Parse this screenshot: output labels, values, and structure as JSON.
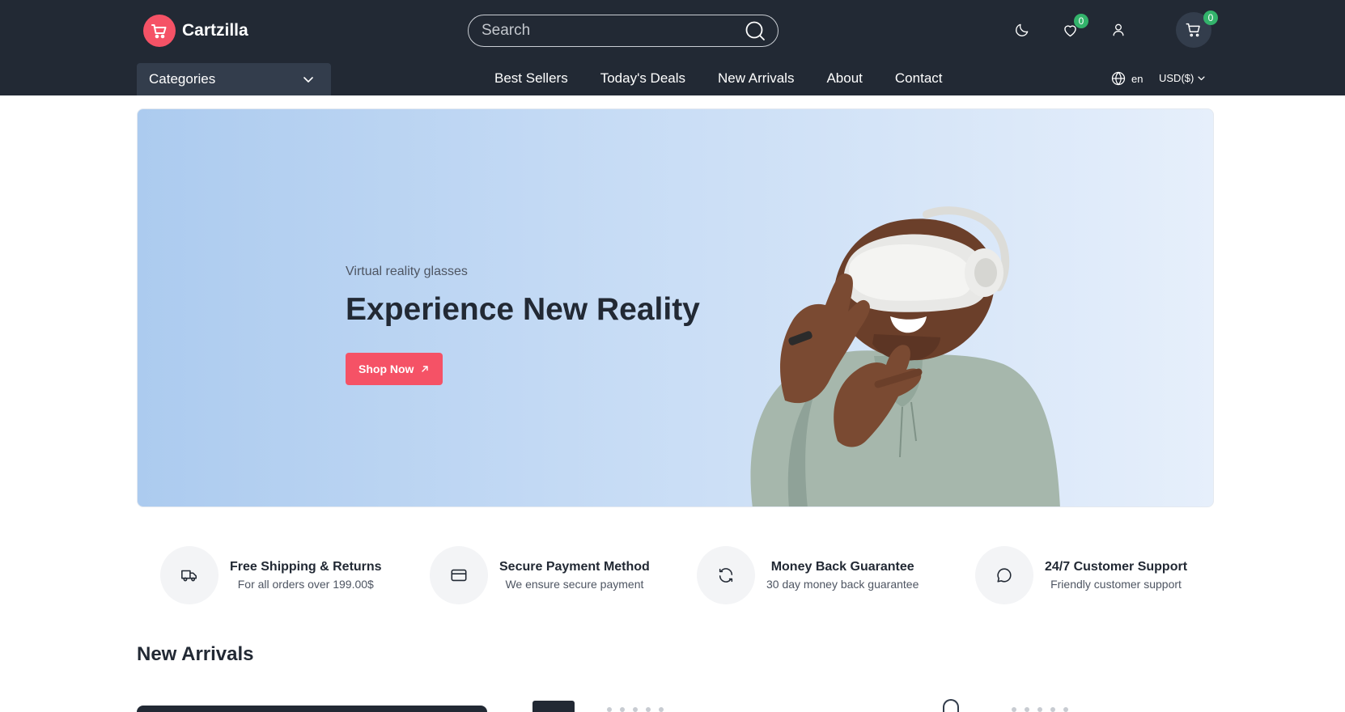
{
  "brand": {
    "name": "Cartzilla",
    "color": "#f55266"
  },
  "header": {
    "search": {
      "placeholder": "Search",
      "value": ""
    },
    "wishlist_count": "0",
    "cart_count": "0",
    "icons": [
      "moon-icon",
      "heart-icon",
      "user-icon",
      "cart-icon"
    ]
  },
  "nav": {
    "categories_label": "Categories",
    "links": [
      "Best Sellers",
      "Today's Deals",
      "New Arrivals",
      "About",
      "Contact"
    ],
    "language": "en",
    "currency": "USD($)"
  },
  "hero": {
    "subtitle": "Virtual reality glasses",
    "title": "Experience New Reality",
    "button_label": "Shop Now"
  },
  "features": [
    {
      "title": "Free Shipping & Returns",
      "description": "For all orders over 199.00$",
      "icon": "truck-icon"
    },
    {
      "title": "Secure Payment Method",
      "description": "We ensure secure payment",
      "icon": "credit-card-icon"
    },
    {
      "title": "Money Back Guarantee",
      "description": "30 day money back guarantee",
      "icon": "refresh-icon"
    },
    {
      "title": "24/7 Customer Support",
      "description": "Friendly customer support",
      "icon": "chat-icon"
    }
  ],
  "sections": {
    "new_arrivals_title": "New Arrivals"
  },
  "colors": {
    "header_bg": "#222934",
    "accent": "#f55266",
    "badge": "#33b36b"
  }
}
